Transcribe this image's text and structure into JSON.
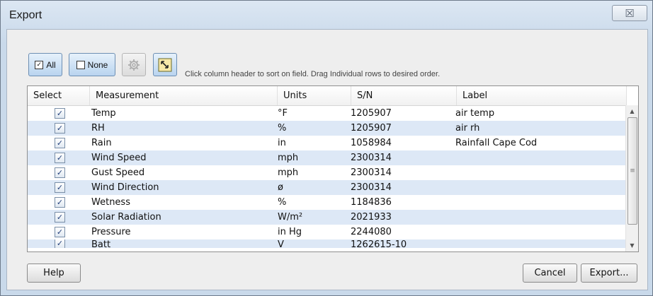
{
  "window": {
    "title": "Export",
    "close_glyph": "☒"
  },
  "toolbar": {
    "all_label": "All",
    "none_label": "None",
    "gear_icon": "gear-icon",
    "resize_icon": "resize-columns-icon",
    "hint": "Click column header to sort on field. Drag Individual rows to desired order."
  },
  "table": {
    "headers": [
      "Select",
      "Measurement",
      "Units",
      "S/N",
      "Label"
    ],
    "rows": [
      {
        "selected": true,
        "measurement": "Temp",
        "units": "°F",
        "sn": "1205907",
        "label": "air temp"
      },
      {
        "selected": true,
        "measurement": "RH",
        "units": "%",
        "sn": "1205907",
        "label": "air rh"
      },
      {
        "selected": true,
        "measurement": "Rain",
        "units": "in",
        "sn": "1058984",
        "label": "Rainfall Cape Cod"
      },
      {
        "selected": true,
        "measurement": "Wind Speed",
        "units": "mph",
        "sn": "2300314",
        "label": ""
      },
      {
        "selected": true,
        "measurement": "Gust Speed",
        "units": "mph",
        "sn": "2300314",
        "label": ""
      },
      {
        "selected": true,
        "measurement": "Wind Direction",
        "units": "ø",
        "sn": "2300314",
        "label": ""
      },
      {
        "selected": true,
        "measurement": "Wetness",
        "units": "%",
        "sn": "1184836",
        "label": ""
      },
      {
        "selected": true,
        "measurement": "Solar Radiation",
        "units": "W/m²",
        "sn": "2021933",
        "label": ""
      },
      {
        "selected": true,
        "measurement": "Pressure",
        "units": "in Hg",
        "sn": "2244080",
        "label": ""
      },
      {
        "selected": true,
        "measurement": "Batt",
        "units": "V",
        "sn": "1262615-10",
        "label": ""
      }
    ]
  },
  "footer": {
    "help": "Help",
    "cancel": "Cancel",
    "export": "Export..."
  },
  "colors": {
    "accent": "#b9d4ef",
    "row_alt": "#dde8f6",
    "frame": "#c9d9ea"
  }
}
